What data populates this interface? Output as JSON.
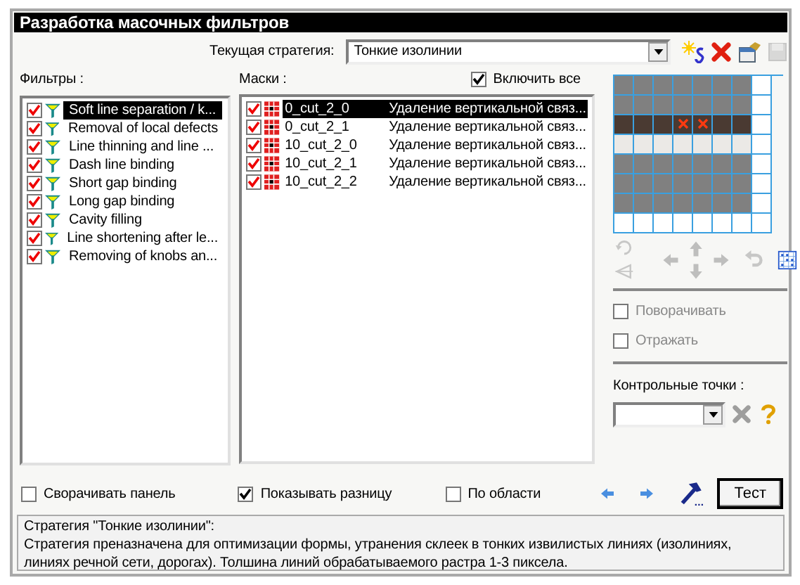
{
  "window": {
    "title": "Разработка масочных фильтров"
  },
  "strategy": {
    "label": "Текущая стратегия:",
    "value": "Тонкие изолинии"
  },
  "strategy_tools": [
    {
      "kind": "new",
      "disabled": false
    },
    {
      "kind": "delete",
      "disabled": false
    },
    {
      "kind": "properties",
      "disabled": false
    },
    {
      "kind": "save",
      "disabled": true
    }
  ],
  "filters": {
    "label": "Фильтры :",
    "items": [
      {
        "name": "Soft line separation / k...",
        "checked": true,
        "selected": true
      },
      {
        "name": "Removal of local defects",
        "checked": true,
        "selected": false
      },
      {
        "name": "Line thinning and line ...",
        "checked": true,
        "selected": false
      },
      {
        "name": "Dash line binding",
        "checked": true,
        "selected": false
      },
      {
        "name": "Short gap binding",
        "checked": true,
        "selected": false
      },
      {
        "name": "Long gap binding",
        "checked": true,
        "selected": false
      },
      {
        "name": "Cavity filling",
        "checked": true,
        "selected": false
      },
      {
        "name": "Line shortening after le...",
        "checked": true,
        "selected": false
      },
      {
        "name": "Removing of knobs an...",
        "checked": true,
        "selected": false
      }
    ]
  },
  "masks": {
    "label": "Маски :",
    "include_all": {
      "label": "Включить все",
      "checked": true
    },
    "items": [
      {
        "name": "0_cut_2_0",
        "description": "Удаление вертикальной связ...",
        "checked": true,
        "selected": true
      },
      {
        "name": "0_cut_2_1",
        "description": "Удаление вертикальной связ...",
        "checked": true,
        "selected": false
      },
      {
        "name": "10_cut_2_0",
        "description": "Удаление вертикальной связ...",
        "checked": true,
        "selected": false
      },
      {
        "name": "10_cut_2_1",
        "description": "Удаление вертикальной связ...",
        "checked": true,
        "selected": false
      },
      {
        "name": "10_cut_2_2",
        "description": "Удаление вертикальной связ...",
        "checked": true,
        "selected": false
      }
    ]
  },
  "mask_grid": {
    "rows": [
      [
        {
          "color": "#808080",
          "marked": false
        },
        {
          "color": "#808080",
          "marked": false
        },
        {
          "color": "#808080",
          "marked": false
        },
        {
          "color": "#808080",
          "marked": false
        },
        {
          "color": "#808080",
          "marked": false
        },
        {
          "color": "#808080",
          "marked": false
        },
        {
          "color": "#808080",
          "marked": false
        },
        {
          "color": "#ffffff",
          "marked": false
        }
      ],
      [
        {
          "color": "#808080",
          "marked": false
        },
        {
          "color": "#808080",
          "marked": false
        },
        {
          "color": "#808080",
          "marked": false
        },
        {
          "color": "#808080",
          "marked": false
        },
        {
          "color": "#808080",
          "marked": false
        },
        {
          "color": "#808080",
          "marked": false
        },
        {
          "color": "#808080",
          "marked": false
        },
        {
          "color": "#ffffff",
          "marked": false
        }
      ],
      [
        {
          "color": "#4a3a32",
          "marked": false
        },
        {
          "color": "#4a3a32",
          "marked": false
        },
        {
          "color": "#4a3a32",
          "marked": false
        },
        {
          "color": "#4a3a32",
          "marked": true
        },
        {
          "color": "#4a3a32",
          "marked": true
        },
        {
          "color": "#4a3a32",
          "marked": false
        },
        {
          "color": "#4a3a32",
          "marked": false
        },
        {
          "color": "#ffffff",
          "marked": false
        }
      ],
      [
        {
          "color": "#ebe9e6",
          "marked": false
        },
        {
          "color": "#ebe9e6",
          "marked": false
        },
        {
          "color": "#ebe9e6",
          "marked": false
        },
        {
          "color": "#ebe9e6",
          "marked": false
        },
        {
          "color": "#ebe9e6",
          "marked": false
        },
        {
          "color": "#ebe9e6",
          "marked": false
        },
        {
          "color": "#ebe9e6",
          "marked": false
        },
        {
          "color": "#ffffff",
          "marked": false
        }
      ],
      [
        {
          "color": "#808080",
          "marked": false
        },
        {
          "color": "#808080",
          "marked": false
        },
        {
          "color": "#808080",
          "marked": false
        },
        {
          "color": "#808080",
          "marked": false
        },
        {
          "color": "#808080",
          "marked": false
        },
        {
          "color": "#808080",
          "marked": false
        },
        {
          "color": "#808080",
          "marked": false
        },
        {
          "color": "#ffffff",
          "marked": false
        }
      ],
      [
        {
          "color": "#808080",
          "marked": false
        },
        {
          "color": "#808080",
          "marked": false
        },
        {
          "color": "#808080",
          "marked": false
        },
        {
          "color": "#808080",
          "marked": false
        },
        {
          "color": "#808080",
          "marked": false
        },
        {
          "color": "#808080",
          "marked": false
        },
        {
          "color": "#808080",
          "marked": false
        },
        {
          "color": "#ffffff",
          "marked": false
        }
      ],
      [
        {
          "color": "#808080",
          "marked": false
        },
        {
          "color": "#808080",
          "marked": false
        },
        {
          "color": "#808080",
          "marked": false
        },
        {
          "color": "#808080",
          "marked": false
        },
        {
          "color": "#808080",
          "marked": false
        },
        {
          "color": "#808080",
          "marked": false
        },
        {
          "color": "#808080",
          "marked": false
        },
        {
          "color": "#ffffff",
          "marked": false
        }
      ],
      [
        {
          "color": "#ffffff",
          "marked": false
        },
        {
          "color": "#ffffff",
          "marked": false
        },
        {
          "color": "#ffffff",
          "marked": false
        },
        {
          "color": "#ffffff",
          "marked": false
        },
        {
          "color": "#ffffff",
          "marked": false
        },
        {
          "color": "#ffffff",
          "marked": false
        },
        {
          "color": "#ffffff",
          "marked": false
        },
        {
          "color": "#ffffff",
          "marked": false
        }
      ]
    ]
  },
  "grid_tools": [
    {
      "kind": "rotate90",
      "disabled": true
    },
    {
      "kind": "flip",
      "disabled": true
    },
    {
      "kind": "left",
      "disabled": true
    },
    {
      "kind": "up",
      "disabled": true
    },
    {
      "kind": "down",
      "disabled": true
    },
    {
      "kind": "right",
      "disabled": true
    },
    {
      "kind": "undo",
      "disabled": true
    },
    {
      "kind": "grid",
      "disabled": false
    }
  ],
  "rotate": {
    "label": "Поворачивать",
    "checked": false,
    "disabled": true
  },
  "reflect": {
    "label": "Отражать",
    "checked": false,
    "disabled": true
  },
  "control_points": {
    "label": "Контрольные точки :",
    "tools": [
      {
        "kind": "delete",
        "disabled": true
      },
      {
        "kind": "help",
        "disabled": false
      }
    ]
  },
  "options": [
    {
      "label": "Сворачивать панель",
      "checked": false
    },
    {
      "label": "Показывать разницу",
      "checked": true
    },
    {
      "label": "По области",
      "checked": false
    }
  ],
  "bottom_tools": [
    {
      "kind": "back",
      "disabled": false
    },
    {
      "kind": "forward",
      "disabled": false
    },
    {
      "kind": "run",
      "disabled": false
    }
  ],
  "test_button": "Тест",
  "description": [
    "Стратегия \"Тонкие изолинии\":",
    "Стратегия преназначена для оптимизации формы, утранения склеек в тонких извилистых линиях (изолиниях, линиях речной сети, дорогах). Толшина линий обрабатываемого растра  1-3 пиксела."
  ]
}
